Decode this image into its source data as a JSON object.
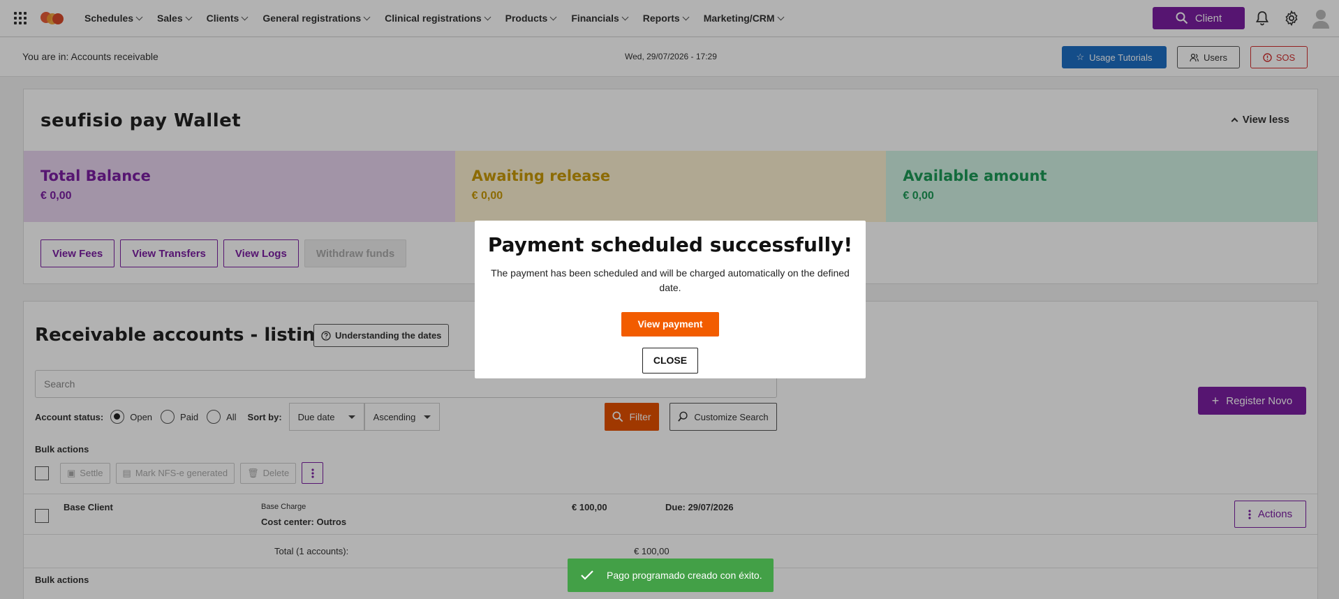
{
  "nav": {
    "menu": [
      {
        "label": "Schedules"
      },
      {
        "label": "Sales"
      },
      {
        "label": "Clients"
      },
      {
        "label": "General registrations"
      },
      {
        "label": "Clinical registrations"
      },
      {
        "label": "Products"
      },
      {
        "label": "Financials"
      },
      {
        "label": "Reports"
      },
      {
        "label": "Marketing/CRM"
      }
    ],
    "client_button": "Client",
    "accent": "#7b1fa2"
  },
  "subheader": {
    "breadcrumb": "You are in: Accounts receivable",
    "datetime": "Wed, 29/07/2026 - 17:29",
    "tutorials": "Usage Tutorials",
    "users": "Users",
    "sos": "SOS"
  },
  "wallet": {
    "title": "seufisio pay Wallet",
    "view_less": "View less",
    "balances": [
      {
        "title": "Total Balance",
        "value": "€ 0,00",
        "bg": "#e8d5f0",
        "color": "#7b1fa2"
      },
      {
        "title": "Awaiting release",
        "value": "€ 0,00",
        "bg": "#fdf1d2",
        "color": "#c99a06"
      },
      {
        "title": "Available amount",
        "value": "€ 0,00",
        "bg": "#d2f2e4",
        "color": "#1c9a57"
      }
    ],
    "actions": {
      "fees": "View Fees",
      "transfers": "View Transfers",
      "logs": "View Logs",
      "withdraw": "Withdraw funds"
    }
  },
  "listing": {
    "title": "Receivable accounts - listing",
    "dates_button": "Understanding the dates",
    "search_placeholder": "Search",
    "register_button": "Register Novo",
    "status_label": "Account status:",
    "status_options": {
      "open": "Open",
      "paid": "Paid",
      "all": "All"
    },
    "sort_label": "Sort by:",
    "sort_field": "Due date",
    "sort_order": "Ascending",
    "filter_button": "Filter",
    "customize_button": "Customize Search",
    "bulk_label": "Bulk actions",
    "bulk": {
      "settle": "Settle",
      "mark": "Mark NFS-e generated",
      "delete": "Delete"
    },
    "rows": [
      {
        "client": "Base Client",
        "charge": "Base Charge",
        "cost_center": "Cost center: Outros",
        "amount": "€ 100,00",
        "due": "Due: 29/07/2026",
        "actions": "Actions"
      }
    ],
    "total_label": "Total (1 accounts):",
    "total_value": "€ 100,00"
  },
  "modal": {
    "title": "Payment scheduled successfully!",
    "text": "The payment has been scheduled and will be charged automatically on the defined date.",
    "view_payment": "View payment",
    "close": "CLOSE"
  },
  "toast": {
    "text": "Pago programado creado con éxito."
  }
}
